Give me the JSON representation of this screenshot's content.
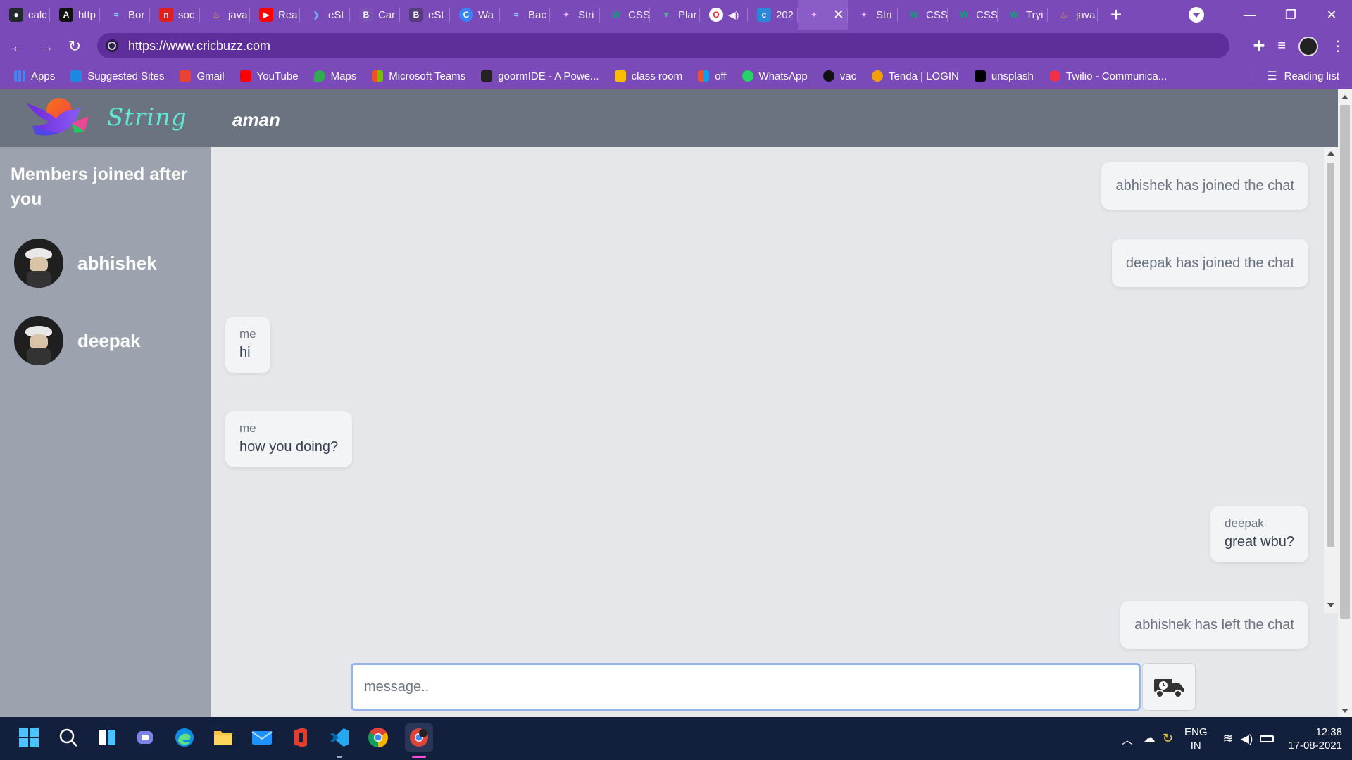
{
  "browser": {
    "tabs": [
      {
        "label": "calc",
        "icon": "github-icon",
        "color": "#24292e"
      },
      {
        "label": "http",
        "icon": "angular-icon",
        "color": "#111111"
      },
      {
        "label": "Bor",
        "icon": "tailwind-icon",
        "color": "#38bdf8"
      },
      {
        "label": "soc",
        "icon": "red-box-icon",
        "color": "#e02020"
      },
      {
        "label": "java",
        "icon": "java-icon",
        "color": "#f0a030"
      },
      {
        "label": "Rea",
        "icon": "youtube-icon",
        "color": "#ff0000"
      },
      {
        "label": "eSt",
        "icon": "feather-icon",
        "color": "#2d9cdb"
      },
      {
        "label": "Car",
        "icon": "bootstrap-icon",
        "color": "#7952b3"
      },
      {
        "label": "eSt",
        "icon": "bootstrap-icon",
        "color": "#563d7c"
      },
      {
        "label": "Wa",
        "icon": "c-icon",
        "color": "#3b82f6"
      },
      {
        "label": "Bac",
        "icon": "tailwind-icon",
        "color": "#38bdf8"
      },
      {
        "label": "Stri",
        "icon": "string-icon",
        "color": "#d946ef"
      },
      {
        "label": "CSS",
        "icon": "w3-icon",
        "color": "#04aa6d"
      },
      {
        "label": "Plar",
        "icon": "vue-icon",
        "color": "#42b883"
      },
      {
        "label": "",
        "icon": "opera-icon",
        "color": "#ff1b2d"
      },
      {
        "label": "202",
        "icon": "edge-icon",
        "color": "#2b88d8"
      },
      {
        "label": "",
        "icon": "string-icon",
        "color": "#d946ef"
      },
      {
        "label": "Stri",
        "icon": "string-icon",
        "color": "#d946ef"
      },
      {
        "label": "CSS",
        "icon": "w3-icon",
        "color": "#04aa6d"
      },
      {
        "label": "CSS",
        "icon": "w3-icon",
        "color": "#04aa6d"
      },
      {
        "label": "Tryi",
        "icon": "w3-icon",
        "color": "#04aa6d"
      },
      {
        "label": "java",
        "icon": "java-icon",
        "color": "#f0a030"
      }
    ],
    "url": "https://www.cricbuzz.com",
    "bookmarks": [
      {
        "label": "Apps",
        "color": "#4285f4"
      },
      {
        "label": "Suggested Sites",
        "color": "#1e88e5"
      },
      {
        "label": "Gmail",
        "color": "#ea4335"
      },
      {
        "label": "YouTube",
        "color": "#ff0000"
      },
      {
        "label": "Maps",
        "color": "#34a853"
      },
      {
        "label": "Microsoft Teams",
        "color": "#f25022"
      },
      {
        "label": "goormIDE - A Powe...",
        "color": "#222222"
      },
      {
        "label": "class room",
        "color": "#fbbc04"
      },
      {
        "label": "off",
        "color": "#f25022"
      },
      {
        "label": "WhatsApp",
        "color": "#25d366"
      },
      {
        "label": "vac",
        "color": "#111111"
      },
      {
        "label": "Tenda | LOGIN",
        "color": "#f59e0b"
      },
      {
        "label": "unsplash",
        "color": "#000000"
      },
      {
        "label": "Twilio - Communica...",
        "color": "#f22f46"
      }
    ],
    "reading_list": "Reading list"
  },
  "app": {
    "brand": "String",
    "user": "aman",
    "sidebar_title": "Members joined after you",
    "members": [
      "abhishek",
      "deepak"
    ],
    "messages": [
      {
        "type": "system",
        "text": "abhishek has joined the chat"
      },
      {
        "type": "system",
        "text": "deepak has joined the chat"
      },
      {
        "type": "message",
        "sender": "me",
        "text": "hi"
      },
      {
        "type": "message",
        "sender": "me",
        "text": "how you doing?"
      },
      {
        "type": "message",
        "sender": "deepak",
        "text": "great wbu?"
      },
      {
        "type": "system",
        "text": "abhishek has left the chat"
      }
    ],
    "composer_placeholder": "message.."
  },
  "taskbar": {
    "lang_top": "ENG",
    "lang_bottom": "IN",
    "time": "12:38",
    "date": "17-08-2021"
  }
}
